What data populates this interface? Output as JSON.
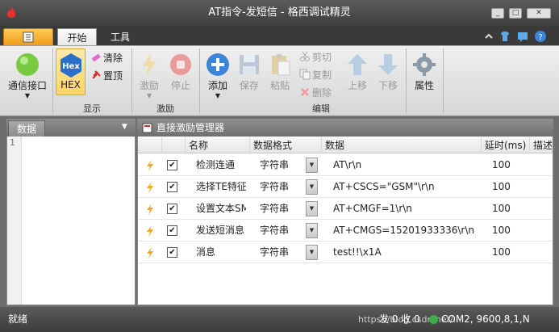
{
  "window": {
    "title": "AT指令-发短信 - 格西调试精灵"
  },
  "ribbon_tabs": {
    "start": "开始",
    "tools": "工具"
  },
  "ribbon": {
    "comm_port": "通信接口",
    "hex": "HEX",
    "hex_icon_text": "Hex",
    "clear": "清除",
    "pin_top": "置顶",
    "excite": "激励",
    "stop": "停止",
    "add": "添加",
    "save": "保存",
    "paste": "粘贴",
    "cut": "剪切",
    "copy": "复制",
    "delete": "删除",
    "move_up": "上移",
    "move_down": "下移",
    "properties": "属性",
    "groups": {
      "display": "显示",
      "excite": "激励",
      "edit": "编辑"
    }
  },
  "left_panel": {
    "tab": "数据",
    "line_number": "1"
  },
  "main_panel": {
    "title": "直接激励管理器",
    "columns": {
      "name": "名称",
      "format": "数据格式",
      "data": "数据",
      "delay": "延时(ms)",
      "desc": "描述"
    },
    "rows": [
      {
        "name": "检测连通",
        "format": "字符串",
        "data": "AT\\r\\n",
        "delay": "100"
      },
      {
        "name": "选择TE特征",
        "format": "字符串",
        "data": "AT+CSCS=\"GSM\"\\r\\n",
        "delay": "100"
      },
      {
        "name": "设置文本SMS",
        "format": "字符串",
        "data": "AT+CMGF=1\\r\\n",
        "delay": "100"
      },
      {
        "name": "发送短消息",
        "format": "字符串",
        "data": "AT+CMGS=15201933336\\r\\n",
        "delay": "100"
      },
      {
        "name": "消息",
        "format": "字符串",
        "data": "test!!\\x1A",
        "delay": "100"
      }
    ]
  },
  "status": {
    "ready": "就绪",
    "counters": "发 0  收 0",
    "port": "COM2, 9600,8,1,N",
    "watermark": "https://blog.csdn.net/..."
  },
  "colors": {
    "accent_orange": "#f09b1b",
    "title_bg": "#3e3e3e",
    "hex_blue": "#2a6fc9"
  }
}
